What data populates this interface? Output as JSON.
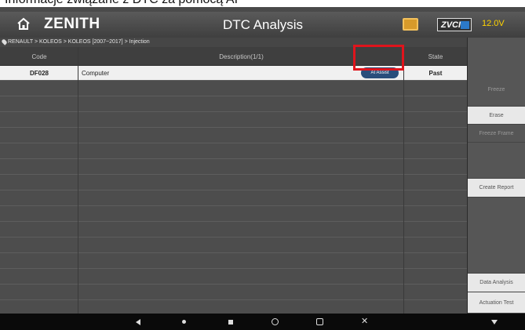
{
  "caption": "Informacje związane z DTC za pomocą AI",
  "app": {
    "logo": "ZENITH",
    "title": "DTC Analysis",
    "vci_label": "ZVCI",
    "battery": "12.0V"
  },
  "breadcrumb": "RENAULT > KOLEOS > KOLEOS [2007~2017] > Injection",
  "table": {
    "headers": {
      "code": "Code",
      "description": "Description(1/1)",
      "state": "State"
    },
    "rows": [
      {
        "code": "DF028",
        "description": "Computer",
        "ai_button": "AI Assist",
        "state": "Past"
      }
    ]
  },
  "sidebar": {
    "buttons": [
      "Freeze",
      "Erase",
      "Freeze Frame",
      "Create Report",
      "Data Analysis",
      "Actuation Test"
    ]
  },
  "colors": {
    "accent": "#294e7b",
    "highlight": "#e0141c",
    "battery": "#ffd400"
  }
}
